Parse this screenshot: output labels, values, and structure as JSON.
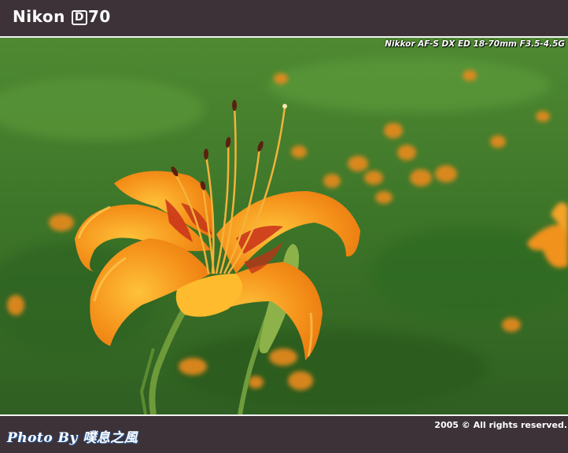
{
  "header": {
    "brand_name": "Nikon",
    "model_letter": "D",
    "model_number": "70"
  },
  "photo": {
    "lens_info": "Nikkor AF-S DX ED 18-70mm F3.5-4.5G",
    "subject": "orange daylily flower against green grass"
  },
  "footer": {
    "copyright": "2005 © All rights reserved.",
    "signature": "Photo By 噗息之風"
  },
  "colors": {
    "frame": "#3c3237",
    "rule": "#f2f2f2",
    "petal": "#f29a1a",
    "grass": "#3f7a2a"
  }
}
